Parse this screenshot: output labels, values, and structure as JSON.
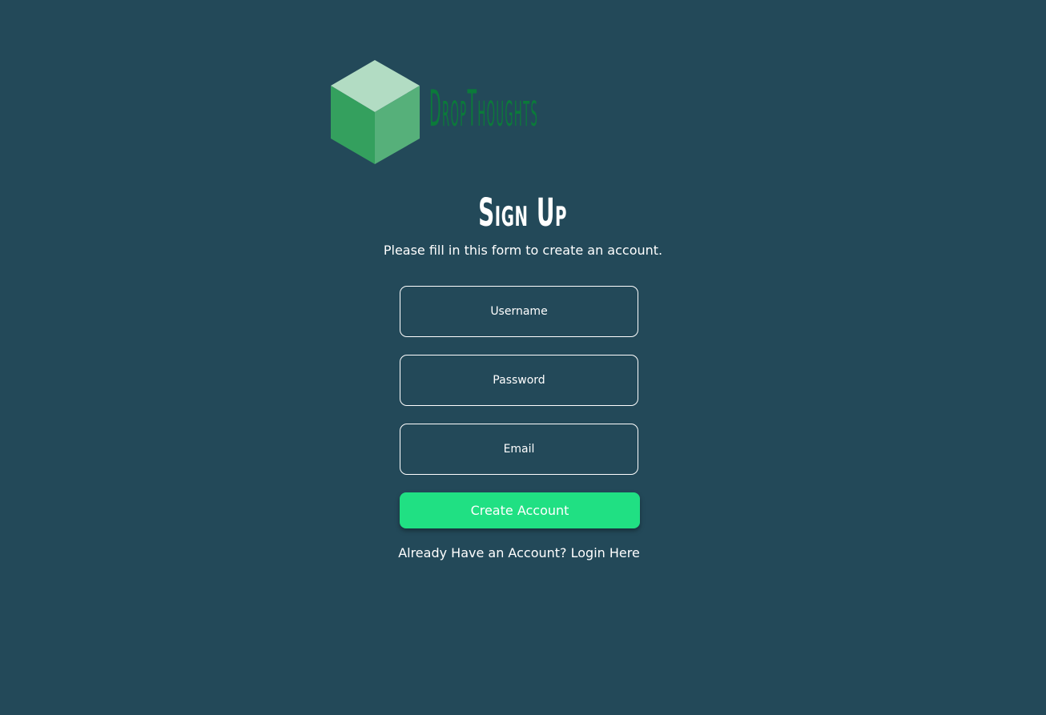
{
  "brand": {
    "name": "DropThoughts",
    "icon": "cube-icon",
    "colors": {
      "background": "#234959",
      "wordmark": "#0b7a3a",
      "cube_top": "#b2dcc3",
      "cube_left": "#34a05e",
      "cube_right": "#56b07a",
      "button": "#20e083"
    }
  },
  "form": {
    "title": "Sign Up",
    "subtitle": "Please fill in this form to create an account.",
    "username_placeholder": "Username",
    "password_placeholder": "Password",
    "email_placeholder": "Email",
    "submit_label": "Create Account",
    "login_link": "Already Have an Account? Login Here"
  }
}
